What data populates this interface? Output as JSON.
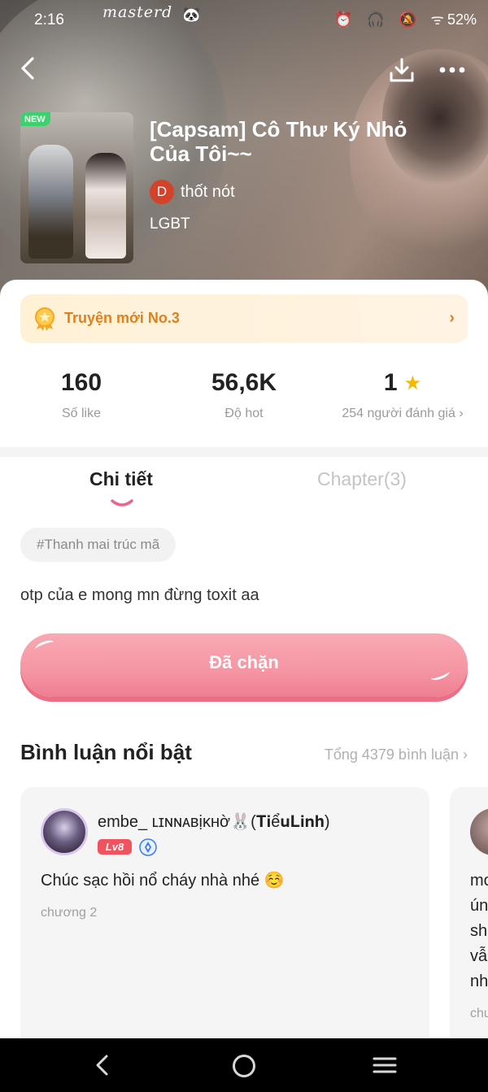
{
  "status": {
    "time": "2:16",
    "watermark": "masterd",
    "system_icons": "⏰ 🎧 🔕 ᯤ",
    "battery": "52%"
  },
  "story": {
    "cover_badge": "NEW",
    "title": "[Capsam] Cô Thư Ký Nhỏ Của Tôi~~",
    "author_initial": "D",
    "author": "thốt nót",
    "genre": "LGBT"
  },
  "ranking": {
    "label": "Truyện mới No.3",
    "color": "#e0801b"
  },
  "stats": {
    "likes_value": "160",
    "likes_label": "Số like",
    "hot_value": "56,6K",
    "hot_label": "Độ hot",
    "rating_value": "1",
    "rating_label": "254 người đánh giá ›"
  },
  "tabs": {
    "detail": "Chi tiết",
    "chapter": "Chapter(3)"
  },
  "detail": {
    "tag": "#Thanh mai trúc mã",
    "description": "otp của e mong mn đừng toxit aa",
    "blocked_button": "Đã chặn"
  },
  "comments": {
    "heading": "Bình luận nổi bật",
    "total": "Tổng 4379 bình luận ›",
    "items": [
      {
        "username": "embe_ ʟɪɴɴᴀʙịᴋʜờ🐰(𝐓𝐢ể𝐮𝐋𝐢𝐧𝐡)",
        "level": "Lv8",
        "text": "Chúc sạc hồi nổ cháy nhà nhé ☺️",
        "chapter": "chương 2"
      },
      {
        "lines": [
          "mo",
          "ún",
          "sh",
          "vẫ",
          "nh"
        ],
        "chapter": "chu"
      }
    ]
  },
  "colors": {
    "accent_pink": "#f595a3",
    "star": "#f5b800"
  }
}
